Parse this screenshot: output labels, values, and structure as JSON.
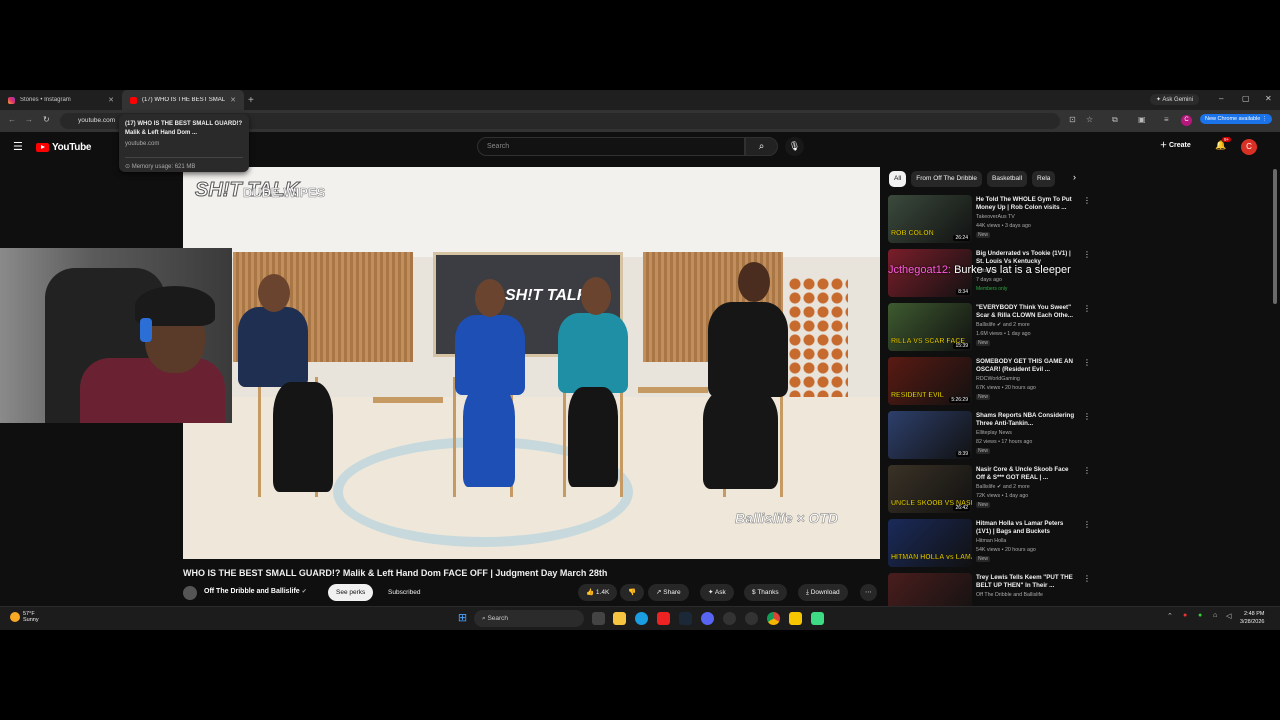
{
  "browser": {
    "tabs": [
      {
        "label": "Stories • Instagram",
        "favicon": "instagram-icon"
      },
      {
        "label": "(17) WHO IS THE BEST SMALL",
        "favicon": "youtube-icon"
      }
    ],
    "gemini_label": "Ask Gemini",
    "address": "youtube.com",
    "profile_initial": "C",
    "update_label": "New Chrome available",
    "hover_card": {
      "title": "(17) WHO IS THE BEST SMALL GUARD!? Malik & Left Hand Dom ...",
      "url": "youtube.com",
      "memory": "Memory usage: 621 MB"
    }
  },
  "youtube": {
    "logo_text": "YouTube",
    "search_placeholder": "Search",
    "create_label": "Create",
    "notif_count": "9+",
    "avatar_initial": "C"
  },
  "video": {
    "title": "WHO IS THE BEST SMALL GUARD!? Malik & Left Hand Dom FACE OFF | Judgment Day March 28th",
    "overlay_logo": "SH!T TALK",
    "overlay_sponsor": "DUDE WIPES",
    "screen_logo": "SH!T TALK",
    "watermark": "Ballislife × OTD",
    "channel": "Off The Dribble and Ballislife",
    "see_perks": "See perks",
    "subscribed": "Subscribed",
    "likes": "1.4K",
    "share": "Share",
    "ask": "Ask",
    "thanks": "Thanks",
    "download": "Download"
  },
  "chips": [
    "All",
    "From Off The Dribble",
    "Basketball",
    "Rela"
  ],
  "recommendations": [
    {
      "title": "He Told The WHOLE Gym To Put Money Up | Rob Colon visits ...",
      "channel": "TakeoverAus TV",
      "meta": "44K views • 3 days ago",
      "badge": "New",
      "duration": "26:24",
      "caption": "ROB COLON",
      "color": "#3b4a3c"
    },
    {
      "title": "Big Underrated vs Tookie (1V1) | St. Louis Vs Kentucky",
      "channel": "YoitsRex",
      "meta": "7 days ago",
      "badge": "Members only",
      "duration": "8:34",
      "caption": "",
      "color": "#7a1e2a"
    },
    {
      "title": "\"EVERYBODY Think You Sweet\" Scar & Rilla CLOWN Each Othe...",
      "channel": "Ballislife",
      "channel_extra": "and 2 more",
      "meta": "1.6M views • 1 day ago",
      "badge": "New",
      "duration": "15:39",
      "caption": "RILLA VS SCAR FACE",
      "color": "#3e5a2f"
    },
    {
      "title": "SOMEBODY GET THIS GAME AN OSCAR! (Resident Evil ...",
      "channel": "RDCWorldGaming",
      "meta": "67K views • 20 hours ago",
      "badge": "New",
      "duration": "5:26:29",
      "caption": "RESIDENT EVIL",
      "color": "#5a1a12"
    },
    {
      "title": "Shams Reports NBA Considering Three Anti-Tankin...",
      "channel": "Elliteplay News",
      "meta": "82 views • 17 hours ago",
      "badge": "New",
      "duration": "8:39",
      "caption": "",
      "color": "#2d3f6b"
    },
    {
      "title": "Nasir Core & Uncle Skoob Face Off & S*** GOT REAL | ...",
      "channel": "Ballislife",
      "channel_extra": "and 2 more",
      "meta": "72K views • 1 day ago",
      "badge": "New",
      "duration": "26:42",
      "caption": "UNCLE SKOOB VS NASIR",
      "color": "#3a3226"
    },
    {
      "title": "Hitman Holla vs Lamar Peters (1V1) | Bags and Buckets",
      "channel": "Hitman Holla",
      "meta": "54K views • 20 hours ago",
      "badge": "New",
      "duration": "",
      "caption": "HITMAN HOLLA vs LAMAR",
      "color": "#1a2a5a"
    },
    {
      "title": "Trey Lewis Tells Keem \"PUT THE BELT UP THEN\" In Their ...",
      "channel": "Off The Dribble and Ballislife",
      "meta": "",
      "badge": "",
      "duration": "",
      "caption": "",
      "color": "#4a1d1d"
    }
  ],
  "chat_overlay": {
    "user": "Jcthegoat12:",
    "message": "Burke vs lat is a sleeper"
  },
  "taskbar": {
    "temperature": "57°F",
    "condition": "Sunny",
    "search_label": "Search",
    "time": "2:48 PM",
    "date": "3/28/2026"
  }
}
